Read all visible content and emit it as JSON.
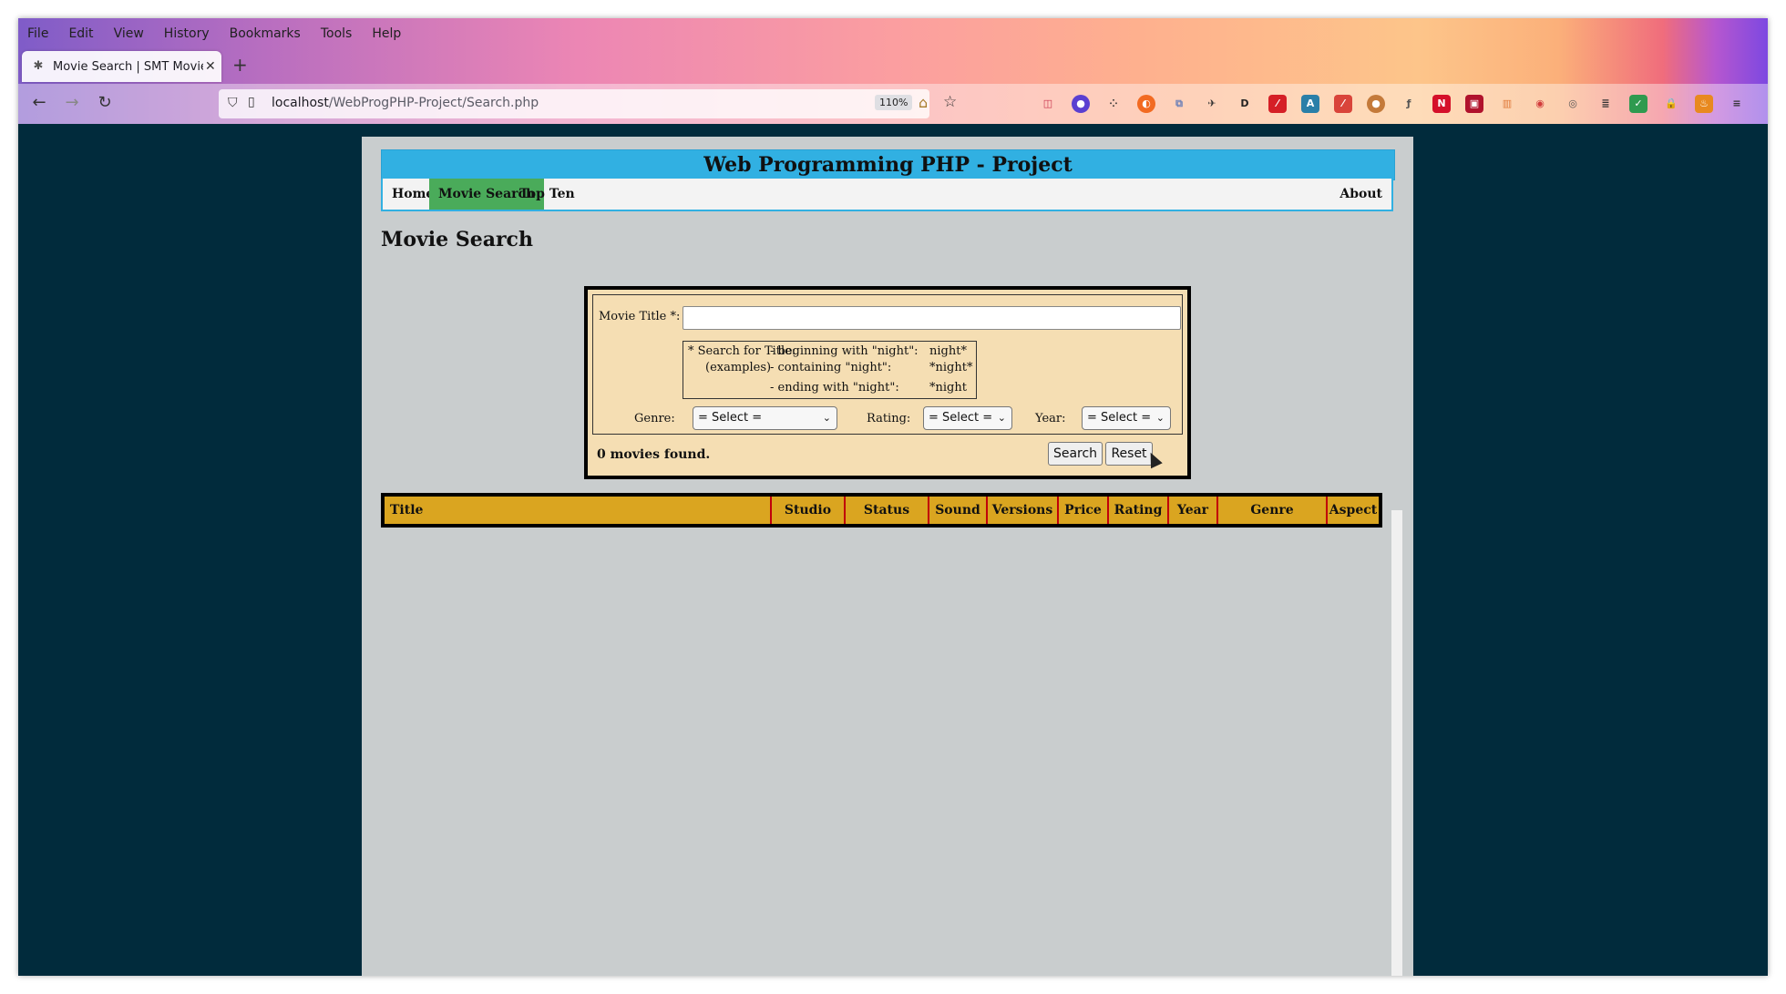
{
  "browser": {
    "menu": [
      "File",
      "Edit",
      "View",
      "History",
      "Bookmarks",
      "Tools",
      "Help"
    ],
    "tab_title": "Movie Search | SMT Movie",
    "url_host": "localhost",
    "url_path": "/WebProgPHP-Project/Search.php",
    "zoom": "110%"
  },
  "site": {
    "banner": "Web Programming PHP - Project",
    "nav": {
      "home": "Home",
      "movie_search": "Movie Search",
      "top_ten": "Top Ten",
      "about": "About"
    }
  },
  "page": {
    "title": "Movie Search",
    "form": {
      "title_label": "Movie Title *:",
      "title_value": "",
      "hint_heading": "* Search for Title:",
      "hint_examples": "(examples)",
      "hints": [
        {
          "desc": "- beginning with \"night\":",
          "pattern": "night*"
        },
        {
          "desc": "- containing \"night\":",
          "pattern": "*night*"
        },
        {
          "desc": "- ending with \"night\":",
          "pattern": "*night"
        }
      ],
      "genre_label": "Genre:",
      "genre_value": "= Select =",
      "rating_label": "Rating:",
      "rating_value": "= Select =",
      "year_label": "Year:",
      "year_value": "= Select =",
      "search_button": "Search",
      "reset_button": "Reset",
      "result_count": "0 movies found."
    },
    "table_headers": [
      "Title",
      "Studio",
      "Status",
      "Sound",
      "Versions",
      "Price",
      "Rating",
      "Year",
      "Genre",
      "Aspect"
    ]
  }
}
